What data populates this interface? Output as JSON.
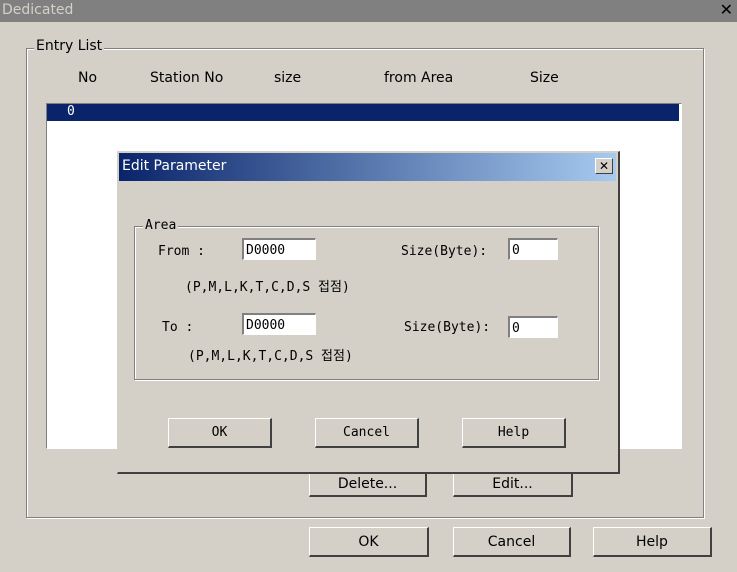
{
  "window": {
    "title": "Dedicated",
    "close_glyph": "✕"
  },
  "entry_list": {
    "group_label": "Entry List",
    "columns": [
      "No",
      "Station No",
      "size",
      "from Area",
      "Size"
    ],
    "rows": [
      {
        "no": "0",
        "selected": true
      }
    ]
  },
  "main_buttons": {
    "delete": "Delete...",
    "edit": "Edit...",
    "ok": "OK",
    "cancel": "Cancel",
    "help": "Help"
  },
  "dialog": {
    "title": "Edit Parameter",
    "close_glyph": "✕",
    "area_label": "Area",
    "from_label": "From :",
    "from_value": "D0000",
    "from_size_label": "Size(Byte):",
    "from_size_value": "0",
    "from_hint": "(P,M,L,K,T,C,D,S 접점)",
    "to_label": "To :",
    "to_value": "D0000",
    "to_size_label": "Size(Byte):",
    "to_size_value": "0",
    "to_hint": "(P,M,L,K,T,C,D,S 접점)",
    "ok": "OK",
    "cancel": "Cancel",
    "help": "Help"
  },
  "colors": {
    "selection": "#0a246a",
    "face": "#d4d0c8",
    "title_gradient_end": "#a6caf0"
  }
}
